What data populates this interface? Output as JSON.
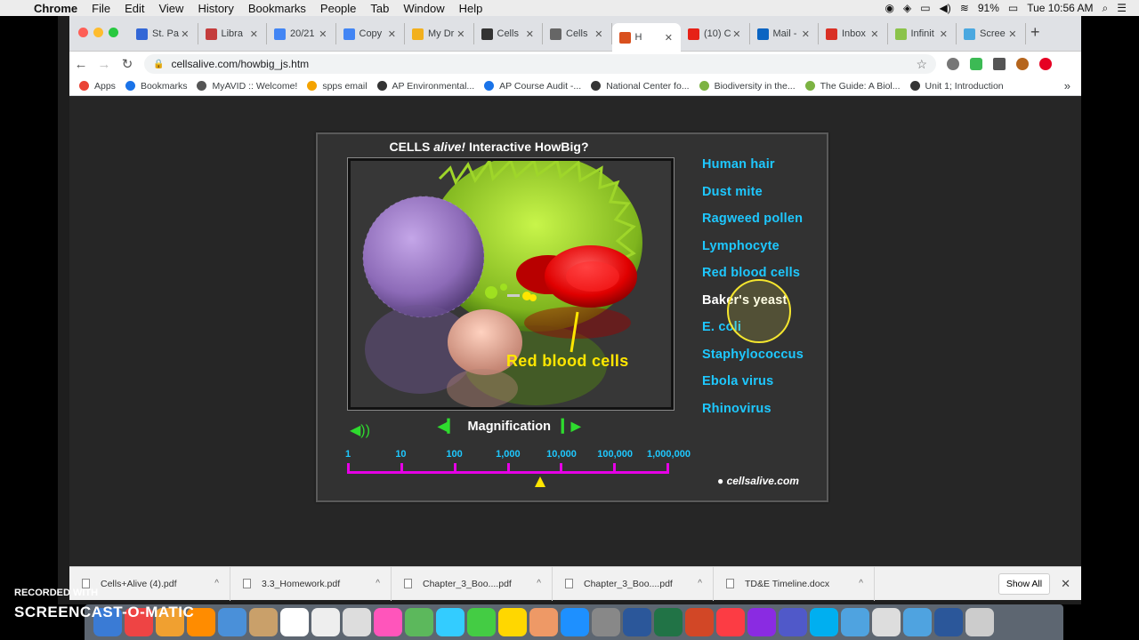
{
  "menubar": {
    "app": "Chrome",
    "items": [
      "File",
      "Edit",
      "View",
      "History",
      "Bookmarks",
      "People",
      "Tab",
      "Window",
      "Help"
    ],
    "battery": "91%",
    "clock": "Tue 10:56 AM"
  },
  "tabs": [
    {
      "label": "St. Pa",
      "color": "#3367d6"
    },
    {
      "label": "Libra",
      "color": "#c43c3c"
    },
    {
      "label": "20/21",
      "color": "#4285f4"
    },
    {
      "label": "Copy",
      "color": "#4285f4"
    },
    {
      "label": "My Dr",
      "color": "#f2b01e"
    },
    {
      "label": "Cells",
      "color": "#333333"
    },
    {
      "label": "Cells",
      "color": "#666666"
    },
    {
      "label": "H",
      "color": "#d9501e",
      "active": true
    },
    {
      "label": "(10) C",
      "color": "#e62117"
    },
    {
      "label": "Mail -",
      "color": "#0a64c2"
    },
    {
      "label": "Inbox",
      "color": "#d93025"
    },
    {
      "label": "Infinit",
      "color": "#8bc34a"
    },
    {
      "label": "Scree",
      "color": "#4aa8e0"
    }
  ],
  "address": {
    "url": "cellsalive.com/howbig_js.htm"
  },
  "bookmarks": [
    {
      "label": "Apps",
      "color": "#ea4335"
    },
    {
      "label": "Bookmarks",
      "color": "#1a73e8"
    },
    {
      "label": "MyAVID :: Welcome!",
      "color": "#555555"
    },
    {
      "label": "spps email",
      "color": "#f4a300"
    },
    {
      "label": "AP Environmental...",
      "color": "#333333"
    },
    {
      "label": "AP Course Audit -...",
      "color": "#1a73e8"
    },
    {
      "label": "National Center fo...",
      "color": "#333333"
    },
    {
      "label": "Biodiversity in the...",
      "color": "#7cb342"
    },
    {
      "label": "The Guide: A Biol...",
      "color": "#7cb342"
    },
    {
      "label": "Unit 1; Introduction",
      "color": "#333333"
    }
  ],
  "widget": {
    "title_pre": "CELLS ",
    "title_em": "alive!",
    "title_post": " Interactive HowBig?",
    "caption": "Red blood cells",
    "items": [
      "Human hair",
      "Dust mite",
      "Ragweed pollen",
      "Lymphocyte",
      "Red blood cells",
      "Baker's yeast",
      "E. coli",
      "Staphylococcus",
      "Ebola virus",
      "Rhinovirus"
    ],
    "selected_index": 5,
    "magnification_label": "Magnification",
    "scale_labels": [
      "1",
      "10",
      "100",
      "1,000",
      "10,000",
      "100,000",
      "1,000,000"
    ],
    "marker_fraction": 0.6,
    "credit": "● cellsalive.com"
  },
  "downloads": [
    {
      "name": "Cells+Alive (4).pdf"
    },
    {
      "name": "3.3_Homework.pdf"
    },
    {
      "name": "Chapter_3_Boo....pdf"
    },
    {
      "name": "Chapter_3_Boo....pdf"
    },
    {
      "name": "TD&E Timeline.docx"
    }
  ],
  "show_all": "Show All",
  "watermark": {
    "line1": "RECORDED WITH",
    "line2": "SCREENCAST-O-MATIC"
  }
}
